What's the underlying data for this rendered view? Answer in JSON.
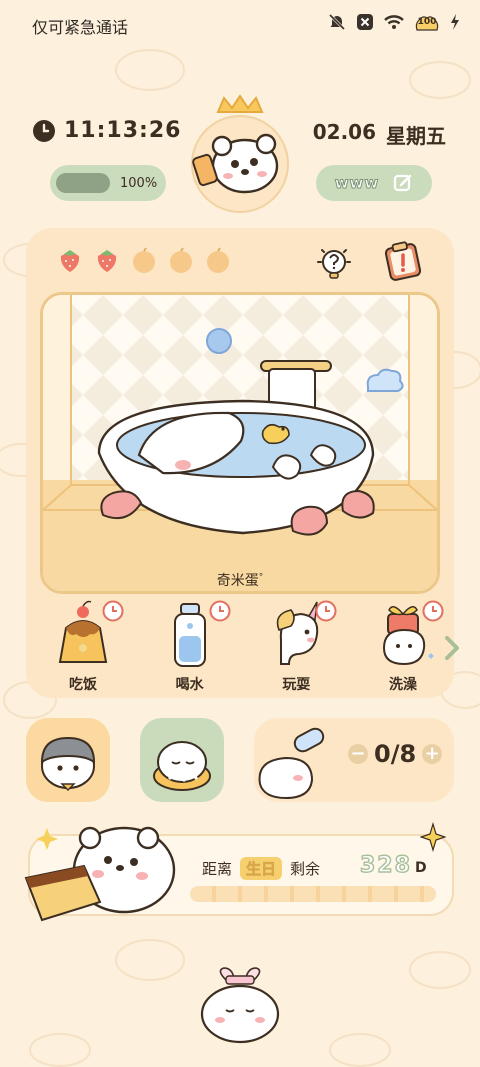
{
  "status_bar": {
    "carrier": "仅可紧急通话",
    "battery": "100",
    "icons": [
      "mute-icon",
      "no-sim-icon",
      "wifi-icon",
      "battery-icon",
      "charging-icon"
    ]
  },
  "widget": {
    "time": "11:13:26",
    "date": "02.06",
    "weekday": "星期五",
    "progress_percent": 100,
    "progress_label": "100%",
    "link_label": "www"
  },
  "pet": {
    "name": "奇米蛋",
    "name_mark": "°",
    "fruits": [
      "strawberry",
      "strawberry",
      "orange",
      "orange",
      "orange"
    ],
    "actions": [
      {
        "label": "吃饭",
        "icon": "pudding-icon"
      },
      {
        "label": "喝水",
        "icon": "water-bottle-icon"
      },
      {
        "label": "玩耍",
        "icon": "unicorn-toy-icon"
      },
      {
        "label": "洗澡",
        "icon": "bath-gift-icon"
      }
    ]
  },
  "water_counter": {
    "value": "0/8",
    "minus": "−",
    "plus": "+"
  },
  "birthday": {
    "prefix": "距离",
    "tag": "生日",
    "suffix": "剩余",
    "days": "328",
    "unit": "D"
  },
  "colors": {
    "background": "#fdf0dc",
    "card": "#fde6c5",
    "green_pill": "#cbdcbc",
    "accent_green": "#8fa286",
    "border_gold": "#ebc88a"
  }
}
